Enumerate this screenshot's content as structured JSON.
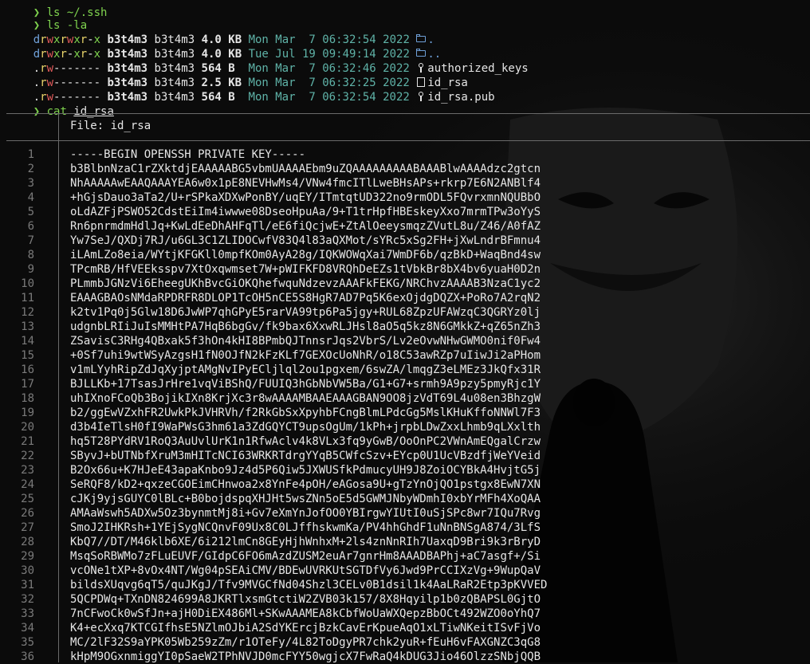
{
  "terminal": {
    "partial_top": "❯ ls ~/.ssh",
    "prompt_symbol": "❯",
    "cmd1": "ls -la",
    "listing": [
      {
        "perms": "drwxrwxr-x",
        "owner": "b3t4m3",
        "group": "b3t4m3",
        "size": "4.0 KB",
        "date": "Mon Mar  7 06:32:54 2022",
        "icon": "folder-open-icon",
        "name": "."
      },
      {
        "perms": "drwxr-xr-x",
        "owner": "b3t4m3",
        "group": "b3t4m3",
        "size": "4.0 KB",
        "date": "Tue Jul 19 09:49:14 2022",
        "icon": "folder-open-icon",
        "name": ".."
      },
      {
        "perms": ".rw-------",
        "owner": "b3t4m3",
        "group": "b3t4m3",
        "size": "564 B ",
        "date": "Mon Mar  7 06:32:46 2022",
        "icon": "key-icon",
        "name": "authorized_keys"
      },
      {
        "perms": ".rw-------",
        "owner": "b3t4m3",
        "group": "b3t4m3",
        "size": "2.5 KB",
        "date": "Mon Mar  7 06:32:25 2022",
        "icon": "file-icon",
        "name": "id_rsa"
      },
      {
        "perms": ".rw-------",
        "owner": "b3t4m3",
        "group": "b3t4m3",
        "size": "564 B ",
        "date": "Mon Mar  7 06:32:54 2022",
        "icon": "key-icon",
        "name": "id_rsa.pub"
      }
    ],
    "cmd2": "cat",
    "cmd2_arg": "id_rsa"
  },
  "bat": {
    "file_label": "File: id_rsa",
    "lines": [
      {
        "n": "1",
        "text": "-----BEGIN OPENSSH PRIVATE KEY-----"
      },
      {
        "n": "2",
        "text": "b3BlbnNzaC1rZXktdjEAAAAABG5vbmUAAAAEbm9uZQAAAAAAAAABAAABlwAAAAdzc2gtcn"
      },
      {
        "n": "3",
        "text": "NhAAAAAwEAAQAAAYEA6w0x1pE8NEVHwMs4/VNw4fmcITlLweBHsAPs+rkrp7E6N2ANBlf4"
      },
      {
        "n": "4",
        "text": "+hGjsDauo3aTa2/U+rSPkaXDXwPonBY/uqEY/ITmtqtUD322no9rmODL5FQvrxmnNQUBbO"
      },
      {
        "n": "5",
        "text": "oLdAZFjPSWO52CdstEiIm4iwwwe08DseoHpuAa/9+T1trHpfHBEskeyXxo7mrmTPw3oYyS"
      },
      {
        "n": "6",
        "text": "Rn6pnrmdmHdlJq+KwLdEeDhAHFqTl/eE6fiQcjwE+ZtAlOeeysmqzZVutL8u/Z46/A0fAZ"
      },
      {
        "n": "7",
        "text": "Yw7SeJ/QXDj7RJ/u6GL3C1ZLIDOCwfV83Q4l83aQXMot/sYRc5xSg2FH+jXwLndrBFmnu4"
      },
      {
        "n": "8",
        "text": "iLAmLZo8eia/WYtjKFGKll0mpfKOm0AyA28g/IQKWOWqXai7WmDF6b/qzBkD+WaqBnd4sw"
      },
      {
        "n": "9",
        "text": "TPcmRB/HfVEEksspv7XtOxqwmset7W+pWIFKFD8VRQhDeEZs1tVbkBr8bX4bv6yuaH0D2n"
      },
      {
        "n": "10",
        "text": "PLmmbJGNzVi6EheegUKhBvcGiOKQhefwquNdzevzAAAFkFEKG/NRChvzAAAAB3NzaC1yc2"
      },
      {
        "n": "11",
        "text": "EAAAGBAOsNMdaRPDRFR8DLOP1TcOH5nCE5S8HgR7AD7Pq5K6exOjdgDQZX+PoRo7A2rqN2"
      },
      {
        "n": "12",
        "text": "k2tv1Pq0j5Glw18D6JwWP7qhGPyE5rarVA99tp6Pa5jgy+RUL68ZpzUFAWzqC3QGRYz0lj"
      },
      {
        "n": "13",
        "text": "udgnbLRIiJuIsMMHtPA7HqB6bgGv/fk9bax6XxwRLJHsl8aO5q5kz8N6GMkkZ+qZ65nZh3"
      },
      {
        "n": "14",
        "text": "ZSavisC3RHg4QBxak5f3hOn4kHI8BPmbQJTnnsrJqs2VbrS/Lv2eOvwNHwGWMO0nif0Fw4"
      },
      {
        "n": "15",
        "text": "+0Sf7uhi9wtWSyAzgsH1fN0OJfN2kFzKLf7GEXOcUoNhR/o18C53awRZp7uIiwJi2aPHom"
      },
      {
        "n": "16",
        "text": "v1mLYyhRipZdJqXyjptAMgNvIPyECljlql2ou1pgxem/6swZA/lmqgZ3eLMEz3JkQfx31R"
      },
      {
        "n": "17",
        "text": "BJLLKb+17TsasJrHre1vqViBShQ/FUUIQ3hGbNbVW5Ba/G1+G7+srmh9A9pzy5pmyRjc1Y"
      },
      {
        "n": "18",
        "text": "uhIXnoFCoQb3BojikIXn8KrjXc3r8wAAAAMBAAEAAAGBAN9OO8jzVdT69L4u08en3BhzgW"
      },
      {
        "n": "19",
        "text": "b2/ggEwVZxhFR2UwkPkJVHRVh/f2RkGbSxXpyhbFCngBlmLPdcGg5MslKHuKffoNNWl7F3"
      },
      {
        "n": "20",
        "text": "d3b4IeTlsH0fI9WaPWsG3hm61a3ZdGQYCT9upsOgUm/1kPh+jrpbLDwZxxLhmb9qLXxlth"
      },
      {
        "n": "21",
        "text": "hq5T28PYdRV1RoQ3AuUvlUrK1n1RfwAclv4k8VLx3fq9yGwB/OoOnPC2VWnAmEQgalCrzw"
      },
      {
        "n": "22",
        "text": "SByvJ+bUTNbfXruM3mHITcNCI63WRKRTdrgYYqB5CWfcSzv+EYcp0U1UcVBzdfjWeYVeid"
      },
      {
        "n": "23",
        "text": "B2Ox66u+K7HJeE43apaKnbo9Jz4d5P6Qiw5JXWUSfkPdmucyUH9J8ZoiOCYBkA4HvjtG5j"
      },
      {
        "n": "24",
        "text": "SeRQF8/kD2+qxzeCGOEimCHnwoa2x8YnFe4pOH/eAGosa9U+gTzYnOjQO1pstgx8EwN7XN"
      },
      {
        "n": "25",
        "text": "cJKj9yjsGUYC0lBLc+B0bojdspqXHJHt5wsZNn5oE5d5GWMJNbyWDmhI0xbYrMFh4XoQAA"
      },
      {
        "n": "26",
        "text": "AMAaWswh5ADXw5Oz3bynmtMj8i+Gv7eXmYnJofOO0YBIrgwYIUtI0uSjSPc8wr7IQu7Rvg"
      },
      {
        "n": "27",
        "text": "SmoJ2IHKRsh+1YEjSygNCQnvF09Ux8C0LJffhskwmKa/PV4hhGhdF1uNnBNSgA874/3LfS"
      },
      {
        "n": "28",
        "text": "KbQ7//DT/M46klb6XE/6i212lmCn8GEyHjhWnhxM+2ls4znNnRIh7UaxqD9Bri9k3rBryD"
      },
      {
        "n": "29",
        "text": "MsqSoRBWMo7zFLuEUVF/GIdpC6FO6mAzdZUSM2euAr7gnrHm8AAADBAPhj+aC7asgf+/Si"
      },
      {
        "n": "30",
        "text": "vcONe1tXP+8vOx4NT/Wg04pSEAiCMV/BDEwUVRKUtSGTDfVy6Jwd9PrCCIXzVg+9WupQaV"
      },
      {
        "n": "31",
        "text": "bildsXUqvg6qT5/quJKgJ/Tfv9MVGCfNd04Shzl3CELv0B1dsil1k4AaLRaR2Etp3pKVVED"
      },
      {
        "n": "32",
        "text": "5QCPDWq+TXnDN824699A8JKRTlxsmGtctiW2ZVB03k157/8X8Hqyilp1b0zQBAPSL0GjtO"
      },
      {
        "n": "33",
        "text": "7nCFwoCk0wSfJn+ajH0DiEX486Ml+SKwAAAMEA8kCbfWoUaWXQepzBbOCt492WZO0oYhQ7"
      },
      {
        "n": "34",
        "text": "K4+ecXxq7KTCGIfhsE5NZlmOJbiA2SdYKErcjBzkCavErKpueAqO1xLTiwNKeitISvFjVo"
      },
      {
        "n": "35",
        "text": "MC/2lF32S9aYPK05Wb259zZm/r1OTeFy/4L82ToDgyPR7chk2yuR+fEuH6vFAXGNZC3qG8"
      },
      {
        "n": "36",
        "text": "kHpM9OGxnmiggYI0pSaeW2TPhNVJD0mcFYY50wgjcX7FwRaQ4kDUG3Jio46OlzzSNbjQQB"
      }
    ]
  },
  "colors": {
    "background": "#0b0b0b",
    "prompt": "#7fd34e",
    "date": "#5fb3a8",
    "directory": "#6fa0d8",
    "line_number": "#7a7a7a"
  },
  "background_art": {
    "icon": "anonymous-mask-wallpaper-icon"
  }
}
